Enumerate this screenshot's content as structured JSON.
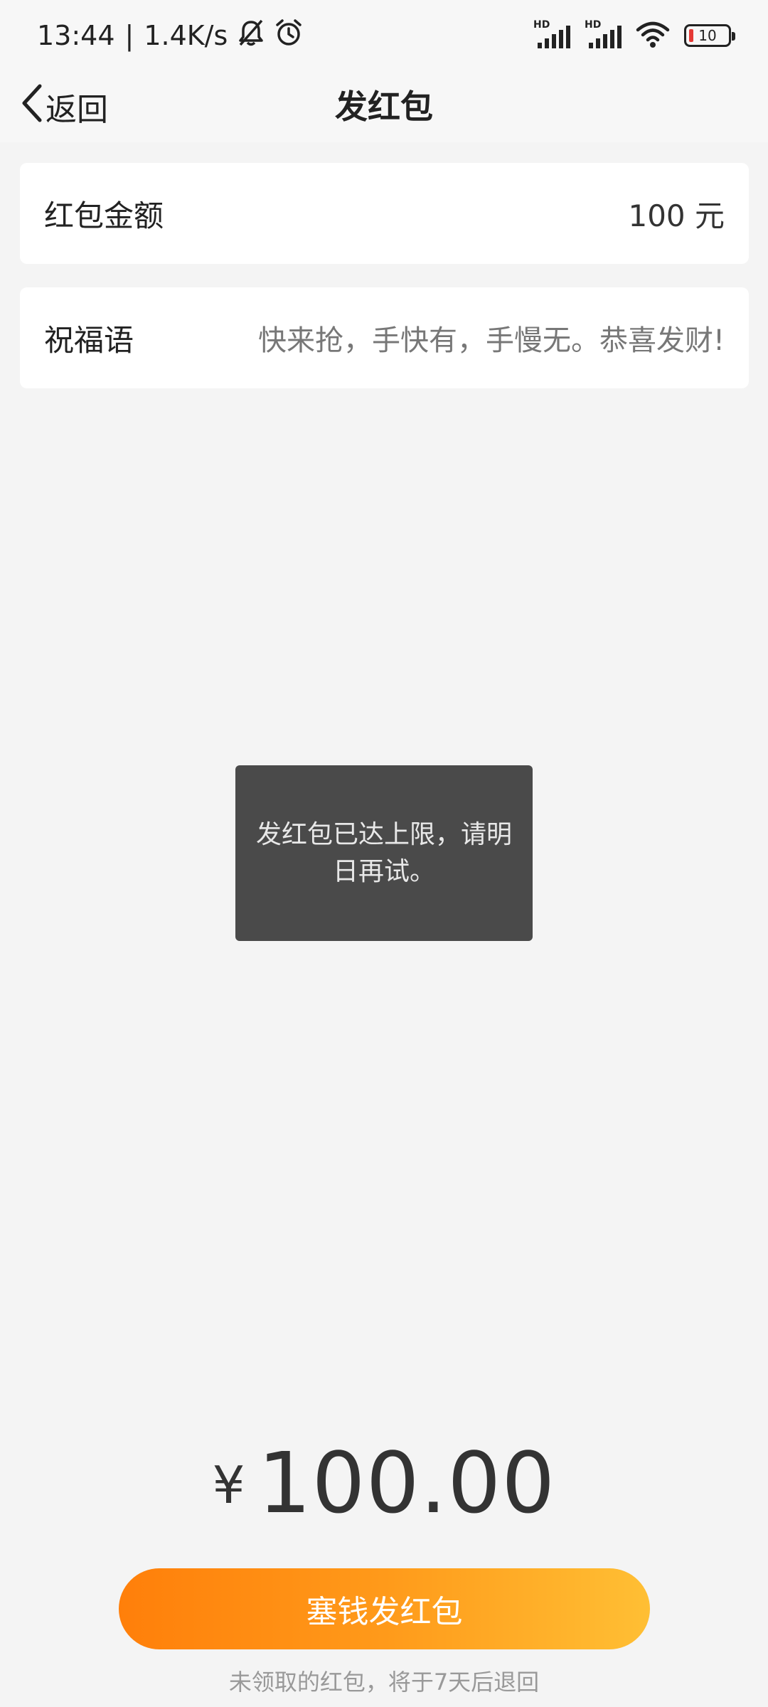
{
  "status_bar": {
    "time": "13:44",
    "separator": "|",
    "speed": "1.4K/s",
    "sim1_label": "HD",
    "sim2_label": "HD",
    "battery": "10"
  },
  "nav": {
    "back_label": "返回",
    "title": "发红包"
  },
  "amount_field": {
    "label": "红包金额",
    "value": "100 元"
  },
  "blessing_field": {
    "label": "祝福语",
    "value": "快来抢，手快有，手慢无。恭喜发财!"
  },
  "toast": {
    "message": "发红包已达上限，请明日再试。"
  },
  "total": {
    "currency": "¥",
    "amount": "100.00"
  },
  "send_button": {
    "label": "塞钱发红包"
  },
  "footer": {
    "note": "未领取的红包，将于7天后退回"
  },
  "colors": {
    "accent_start": "#ff7f0a",
    "accent_end": "#ffbf34",
    "toast_bg": "#4a4a4a",
    "battery_low": "#e53935"
  }
}
